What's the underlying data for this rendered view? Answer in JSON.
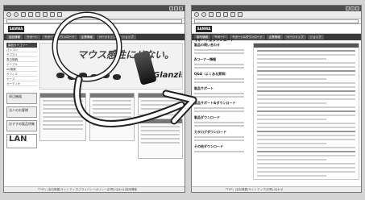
{
  "left_window": {
    "logo": "SANWA",
    "headline": "マウス感性にせない。",
    "brand": "Glanzis",
    "nav": [
      "製品情報",
      "サポート",
      "サポート&ダウンロード",
      "企業情報",
      "ページトップ",
      "ショップ"
    ],
    "sidebar_heading": "製品カテゴリー",
    "sidebar_items": [
      "パソコン",
      "サプライ",
      "周辺機器",
      "ケーブル",
      "AV機器",
      "オフィス",
      "ケース",
      "オーディオ"
    ],
    "promos": [
      "周辺機器",
      "法人のお客様",
      "おすすめ製品特集"
    ],
    "promo_lan": "LAN",
    "footer": "「TOP」|会社概要|サイトマップ|プライバシーポリシー|お問い合わせ|採用情報"
  },
  "right_window": {
    "logo": "SANWA",
    "nav": [
      "製品情報",
      "サポート",
      "サポート&ダウンロード",
      "企業情報",
      "ページトップ",
      "ショップ"
    ],
    "subhead": "サポート＆ダウンロード",
    "sections": [
      "製品の問い合わせ",
      "Aコーナー情報",
      "Q&A（よくある質問）",
      "製品サポート",
      "製品サポート&ダウンロード",
      "製品ダウンロード",
      "カタログダウンロード",
      "その他ダウンロード"
    ],
    "footer": "「TOP」|会社概要|サイトマップ|お問い合わせ"
  },
  "colors": {
    "arrow": "#ffffff",
    "arrow_outline": "#222222",
    "circle": "#ffffff"
  }
}
